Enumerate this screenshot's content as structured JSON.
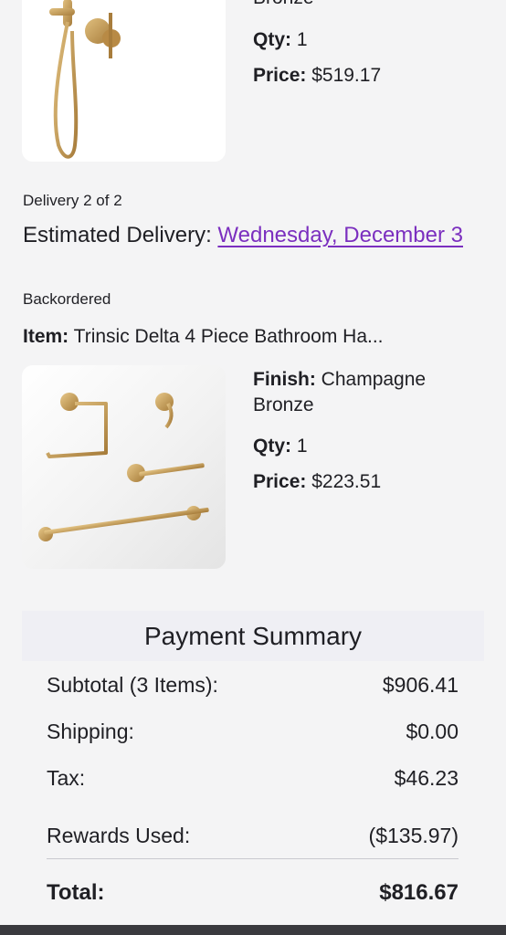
{
  "item1": {
    "finish_value_fragment": "Bronze",
    "qty_label": "Qty:",
    "qty_value": "1",
    "price_label": "Price:",
    "price_value": "$519.17"
  },
  "delivery2": {
    "count_text": "Delivery 2 of 2",
    "estimated_label": "Estimated Delivery:",
    "date_link": "Wednesday, December 3",
    "status": "Backordered",
    "item_label": "Item:",
    "item_name": "Trinsic Delta 4 Piece Bathroom Ha..."
  },
  "item2": {
    "finish_label": "Finish:",
    "finish_value": "Champagne Bronze",
    "qty_label": "Qty:",
    "qty_value": "1",
    "price_label": "Price:",
    "price_value": "$223.51"
  },
  "summary": {
    "title": "Payment Summary",
    "subtotal_label": "Subtotal (3 Items):",
    "subtotal_value": "$906.41",
    "shipping_label": "Shipping:",
    "shipping_value": "$0.00",
    "tax_label": "Tax:",
    "tax_value": "$46.23",
    "rewards_label": "Rewards Used:",
    "rewards_value": "($135.97)",
    "total_label": "Total:",
    "total_value": "$816.67"
  },
  "colors": {
    "link": "#7b2fbf",
    "brass": "#c9a25c"
  }
}
